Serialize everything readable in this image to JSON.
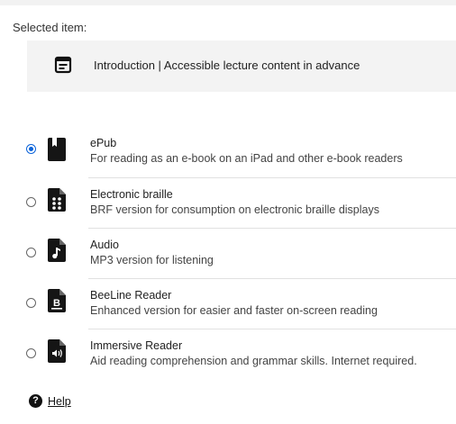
{
  "selected_item": {
    "label": "Selected item:",
    "icon": "document-icon",
    "title": "Introduction | Accessible lecture content in advance"
  },
  "accent_color": "#0b63d9",
  "options": [
    {
      "id": "epub",
      "title": "ePub",
      "description": "For reading as an e-book on an iPad and other e-book readers",
      "icon": "book-icon",
      "checked": true
    },
    {
      "id": "braille",
      "title": "Electronic braille",
      "description": "BRF version for consumption on electronic braille displays",
      "icon": "braille-file-icon",
      "checked": false
    },
    {
      "id": "audio",
      "title": "Audio",
      "description": "MP3 version for listening",
      "icon": "audio-file-icon",
      "checked": false
    },
    {
      "id": "beeline",
      "title": "BeeLine Reader",
      "description": "Enhanced version for easier and faster on-screen reading",
      "icon": "beeline-file-icon",
      "checked": false
    },
    {
      "id": "immersive",
      "title": "Immersive Reader",
      "description": "Aid reading comprehension and grammar skills. Internet required.",
      "icon": "immersive-reader-icon",
      "checked": false
    }
  ],
  "help": {
    "label": "Help",
    "icon": "help-icon"
  }
}
